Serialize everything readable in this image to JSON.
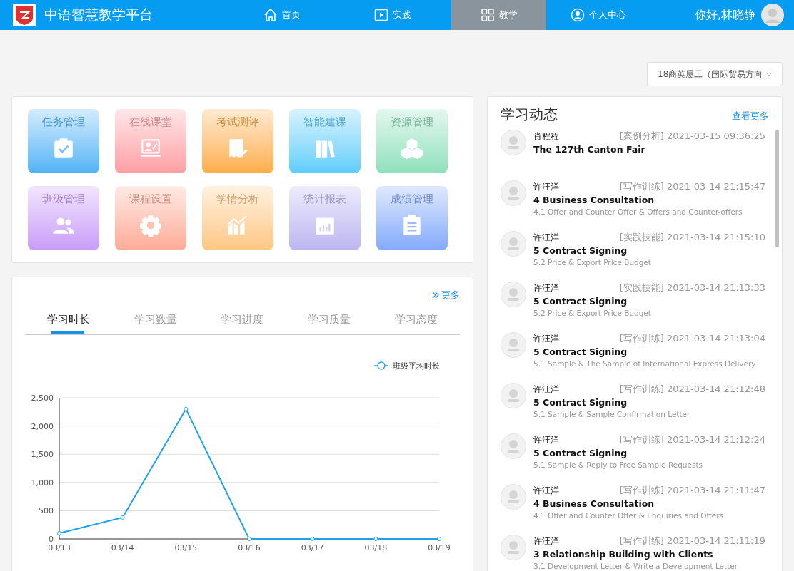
{
  "header": {
    "title": "中语智慧教学平台",
    "nav": [
      {
        "label": "首页",
        "selected": false
      },
      {
        "label": "实践",
        "selected": false
      },
      {
        "label": "教学",
        "selected": true
      },
      {
        "label": "个人中心",
        "selected": false
      }
    ],
    "greeting": "你好,林晓静"
  },
  "class_select": {
    "value": "18商英厦工（国际贸易方向"
  },
  "modules": [
    {
      "label": "任务管理",
      "color": "#4fb3f6"
    },
    {
      "label": "在线课堂",
      "color": "#ff9fa4"
    },
    {
      "label": "考试测评",
      "color": "#ffad45"
    },
    {
      "label": "智能建课",
      "color": "#5ccdfb"
    },
    {
      "label": "资源管理",
      "color": "#8ee0bd"
    },
    {
      "label": "班级管理",
      "color": "#c99cf7"
    },
    {
      "label": "课程设置",
      "color": "#ffab98"
    },
    {
      "label": "学情分析",
      "color": "#ffc783"
    },
    {
      "label": "统计报表",
      "color": "#bcb5f1"
    },
    {
      "label": "成绩管理",
      "color": "#84a9fa"
    }
  ],
  "stats": {
    "more": "更多",
    "tabs": [
      {
        "label": "学习时长",
        "selected": true
      },
      {
        "label": "学习数量",
        "selected": false
      },
      {
        "label": "学习进度",
        "selected": false
      },
      {
        "label": "学习质量",
        "selected": false
      },
      {
        "label": "学习态度",
        "selected": false
      }
    ],
    "chart_data": {
      "type": "line",
      "grid": true,
      "categories": [
        "03/13",
        "03/14",
        "03/15",
        "03/16",
        "03/17",
        "03/18",
        "03/19"
      ],
      "ylim": [
        0,
        2500
      ],
      "yticks": [
        {
          "value": 0,
          "label": "0"
        },
        {
          "value": 500,
          "label": "500"
        },
        {
          "value": 1000,
          "label": "1,000"
        },
        {
          "value": 1500,
          "label": "1,500"
        },
        {
          "value": 2000,
          "label": "2,000"
        },
        {
          "value": 2500,
          "label": "2,500"
        }
      ],
      "series": [
        {
          "name": "班级平均时长",
          "color": "#1fa2e6",
          "values": [
            100,
            380,
            2300,
            0,
            0,
            0,
            0
          ],
          "marker": true
        }
      ]
    }
  },
  "feed": {
    "title": "学习动态",
    "more": "查看更多",
    "items": [
      {
        "name": "肖程程",
        "tag": "[案例分析]",
        "time": "2021-03-15 09:36:25",
        "title": "The 127th Canton Fair"
      },
      {
        "name": "许汪洋",
        "tag": "[写作训练]",
        "time": "2021-03-14 21:15:47",
        "title": "4 Business Consultation",
        "subtitle": "4.1 Offer and Counter Offer & Offers and Counter-offers"
      },
      {
        "name": "许汪洋",
        "tag": "[实践技能]",
        "time": "2021-03-14 21:15:10",
        "title": "5 Contract Signing",
        "subtitle": "5.2 Price & Export Price Budget"
      },
      {
        "name": "许汪洋",
        "tag": "[实践技能]",
        "time": "2021-03-14 21:13:33",
        "title": "5 Contract Signing",
        "subtitle": "5.2 Price & Export Price Budget"
      },
      {
        "name": "许汪洋",
        "tag": "[写作训练]",
        "time": "2021-03-14 21:13:04",
        "title": "5 Contract Signing",
        "subtitle": "5.1 Sample & The Sample of International Express Delivery"
      },
      {
        "name": "许汪洋",
        "tag": "[写作训练]",
        "time": "2021-03-14 21:12:48",
        "title": "5 Contract Signing",
        "subtitle": "5.1 Sample & Sample Confirmation Letter"
      },
      {
        "name": "许汪洋",
        "tag": "[写作训练]",
        "time": "2021-03-14 21:12:24",
        "title": "5 Contract Signing",
        "subtitle": "5.1 Sample & Reply to Free Sample Requests"
      },
      {
        "name": "许汪洋",
        "tag": "[写作训练]",
        "time": "2021-03-14 21:11:47",
        "title": "4 Business Consultation",
        "subtitle": "4.1 Offer and Counter Offer & Enquiries and Offers"
      },
      {
        "name": "许汪洋",
        "tag": "[写作训练]",
        "time": "2021-03-14 21:11:19",
        "title": "3 Relationship Building with Clients",
        "subtitle": "3.1 Development Letter & Write a Development Letter"
      }
    ]
  }
}
